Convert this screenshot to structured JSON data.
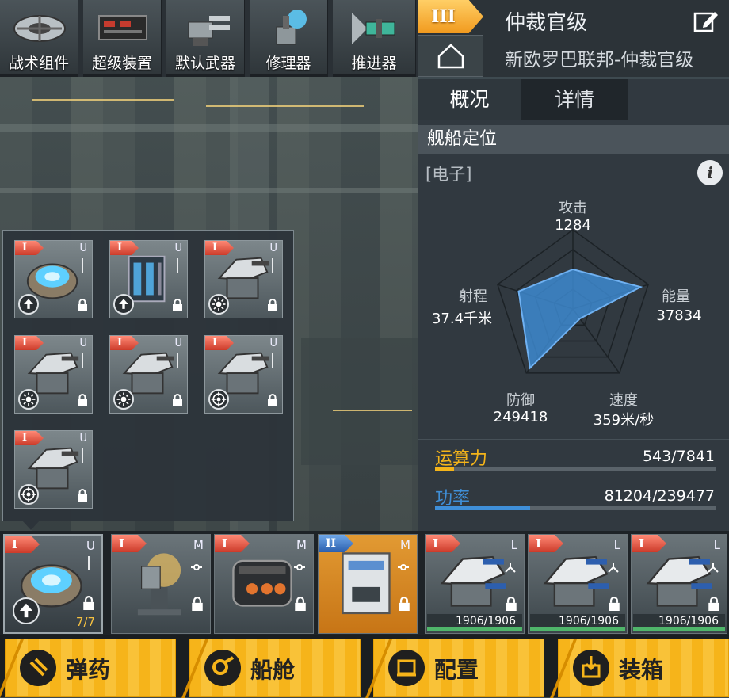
{
  "top_tabs": [
    {
      "label": "战术组件",
      "icon": "tactical-component-icon"
    },
    {
      "label": "超级装置",
      "icon": "super-device-icon"
    },
    {
      "label": "默认武器",
      "icon": "default-weapon-icon"
    },
    {
      "label": "修理器",
      "icon": "repairer-icon"
    },
    {
      "label": "推进器",
      "icon": "thruster-icon"
    }
  ],
  "header": {
    "tier": "III",
    "ship_title": "仲裁官级",
    "ship_subtitle": "新欧罗巴联邦-仲裁官级",
    "edit_icon": "edit-icon",
    "home_icon": "home-icon"
  },
  "panel": {
    "tabs": [
      {
        "label": "概况",
        "active": true
      },
      {
        "label": "详情",
        "active": false
      }
    ],
    "section_title": "舰船定位",
    "ship_type": "[电子]",
    "info_icon": "i",
    "radar": {
      "attack": {
        "label": "攻击",
        "value": "1284",
        "level": 0.5
      },
      "energy": {
        "label": "能量",
        "value": "37834",
        "level": 0.9
      },
      "speed": {
        "label": "速度",
        "value": "359米/秒",
        "level": 0.15
      },
      "defense": {
        "label": "防御",
        "value": "249418",
        "level": 0.92
      },
      "range": {
        "label": "射程",
        "value": "37.4千米",
        "level": 0.72
      }
    },
    "compute": {
      "label": "运算力",
      "value": "543/7841",
      "fraction": 0.069,
      "color": "#f4b41a"
    },
    "power": {
      "label": "功率",
      "value": "81204/239477",
      "fraction": 0.339,
      "color": "#3f8fd8"
    }
  },
  "popup_modules": [
    {
      "tier": "I",
      "slot": "U",
      "kind": "reactor",
      "badge": "up"
    },
    {
      "tier": "I",
      "slot": "U",
      "kind": "battery",
      "badge": "up"
    },
    {
      "tier": "I",
      "slot": "U",
      "kind": "turret",
      "badge": "sun"
    },
    {
      "tier": "I",
      "slot": "U",
      "kind": "turret",
      "badge": "sun"
    },
    {
      "tier": "I",
      "slot": "U",
      "kind": "turret",
      "badge": "sun"
    },
    {
      "tier": "I",
      "slot": "U",
      "kind": "turret",
      "badge": "target"
    },
    {
      "tier": "I",
      "slot": "U",
      "kind": "turret",
      "badge": "target"
    }
  ],
  "slots": [
    {
      "tier": "I",
      "slot": "U",
      "kind": "reactor",
      "count": "7/7"
    },
    {
      "tier": "I",
      "slot": "M",
      "kind": "tower"
    },
    {
      "tier": "I",
      "slot": "M",
      "kind": "engine"
    },
    {
      "tier": "II",
      "slot": "M",
      "kind": "crate"
    },
    {
      "tier": "I",
      "slot": "L",
      "kind": "cannon",
      "hp": "1906/1906"
    },
    {
      "tier": "I",
      "slot": "L",
      "kind": "cannon",
      "hp": "1906/1906"
    },
    {
      "tier": "I",
      "slot": "L",
      "kind": "cannon",
      "hp": "1906/1906"
    }
  ],
  "actions": [
    {
      "label": "弹药",
      "icon": "ammo-icon"
    },
    {
      "label": "船舱",
      "icon": "cabin-icon"
    },
    {
      "label": "配置",
      "icon": "config-icon"
    },
    {
      "label": "装箱",
      "icon": "crate-icon"
    }
  ]
}
